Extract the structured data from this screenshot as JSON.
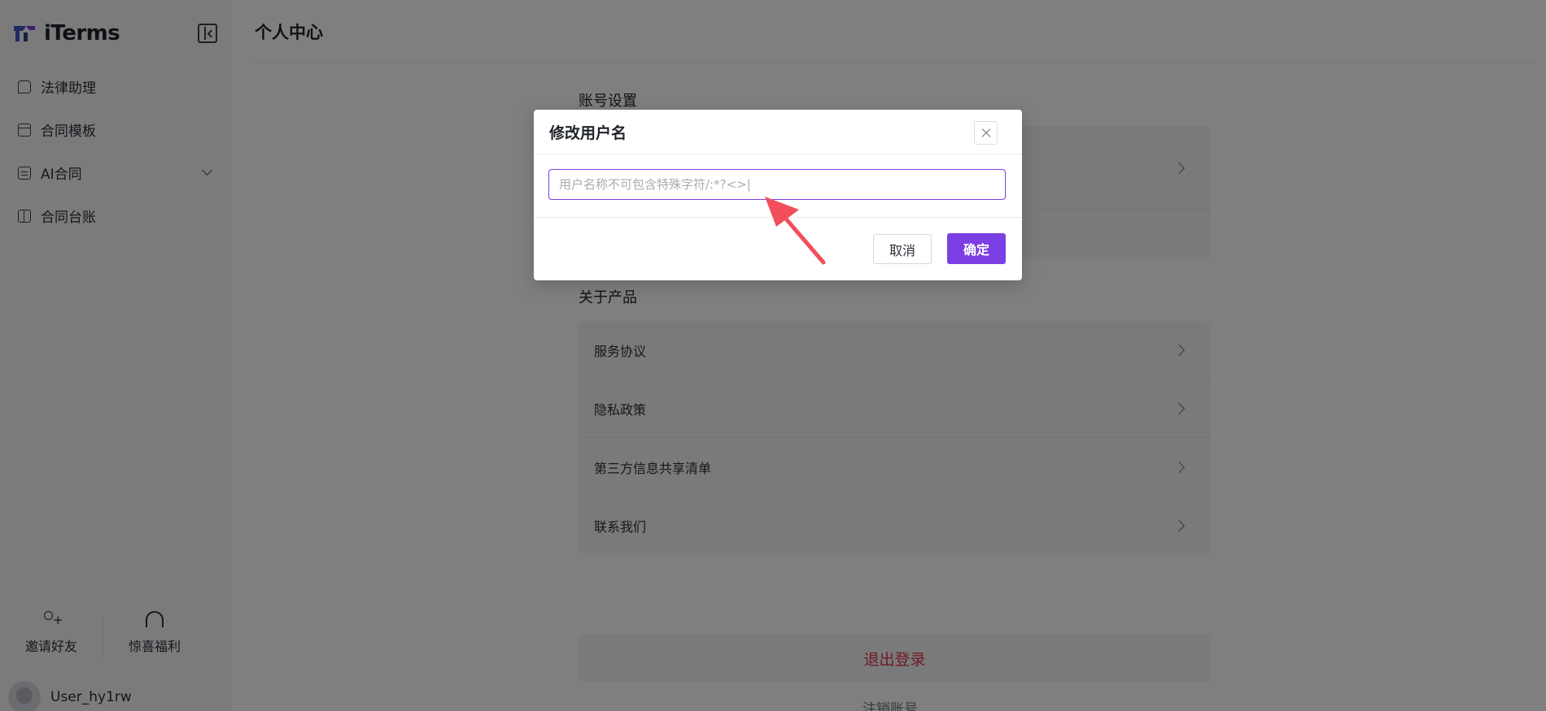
{
  "app": {
    "name": "iTerms"
  },
  "sidebar": {
    "items": [
      {
        "label": "法律助理",
        "icon": "chat-icon"
      },
      {
        "label": "合同模板",
        "icon": "archive-icon"
      },
      {
        "label": "AI合同",
        "icon": "document-icon",
        "expandable": true
      },
      {
        "label": "合同台账",
        "icon": "book-icon"
      }
    ],
    "bottom": {
      "invite_label": "邀请好友",
      "surprise_label": "惊喜福利"
    },
    "user": {
      "name": "User_hy1rw"
    }
  },
  "main": {
    "title": "个人中心",
    "account_section": {
      "label": "账号设置"
    },
    "product_section": {
      "label": "关于产品",
      "rows": [
        {
          "label": "服务协议"
        },
        {
          "label": "隐私政策"
        },
        {
          "label": "第三方信息共享清单"
        },
        {
          "label": "联系我们"
        }
      ]
    },
    "logout_label": "退出登录",
    "delete_account_label": "注销账号"
  },
  "modal": {
    "title": "修改用户名",
    "input_placeholder": "用户名称不可包含特殊字符/:*?<>|",
    "input_value": "",
    "cancel_label": "取消",
    "confirm_label": "确定"
  },
  "colors": {
    "accent": "#7b3fe4",
    "danger": "#e3334b",
    "overlay": "rgba(0,0,0,0.5)",
    "annotation_arrow": "#f24e5b"
  }
}
